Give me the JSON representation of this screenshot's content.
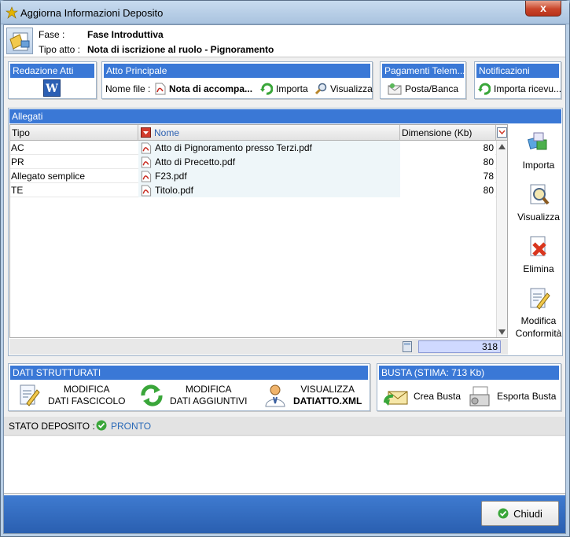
{
  "window": {
    "title": "Aggiorna Informazioni Deposito",
    "close_label": "x"
  },
  "header": {
    "fase_label": "Fase :",
    "fase_value": "Fase Introduttiva",
    "tipo_label": "Tipo atto :",
    "tipo_value": "Nota di iscrizione al ruolo - Pignoramento"
  },
  "redazione": {
    "title": "Redazione Atti",
    "icon": "word-icon"
  },
  "atto_principale": {
    "title": "Atto Principale",
    "file_label": "Nome file :",
    "file_name": "Nota di accompa...",
    "importa": "Importa",
    "visualizza": "Visualizza"
  },
  "pagamenti": {
    "title": "Pagamenti Telem...",
    "action": "Posta/Banca"
  },
  "notifiche": {
    "title": "Notificazioni",
    "action": "Importa ricevu..."
  },
  "allegati": {
    "title": "Allegati",
    "columns": {
      "tipo": "Tipo",
      "nome": "Nome",
      "dimensione": "Dimensione (Kb)"
    },
    "rows": [
      {
        "tipo": "AC",
        "nome": "Atto di Pignoramento presso Terzi.pdf",
        "dim": "80"
      },
      {
        "tipo": "PR",
        "nome": "Atto di Precetto.pdf",
        "dim": "80"
      },
      {
        "tipo": "Allegato semplice",
        "nome": "F23.pdf",
        "dim": "78"
      },
      {
        "tipo": "TE",
        "nome": "Titolo.pdf",
        "dim": "80"
      }
    ],
    "total": "318"
  },
  "side_actions": {
    "importa": "Importa",
    "visualizza": "Visualizza",
    "elimina": "Elimina",
    "modifica_1": "Modifica",
    "modifica_2": "Conformità"
  },
  "dati_strutturati": {
    "title": "DATI STRUTTURATI",
    "fascicolo_1": "MODIFICA",
    "fascicolo_2": "DATI FASCICOLO",
    "aggiuntivi_1": "MODIFICA",
    "aggiuntivi_2": "DATI AGGIUNTIVI",
    "visualizza_1": "VISUALIZZA",
    "visualizza_2": "DATIATTO.XML"
  },
  "busta": {
    "title": "BUSTA (STIMA: 713 Kb)",
    "crea": "Crea Busta",
    "esporta": "Esporta Busta"
  },
  "stato": {
    "label": "STATO DEPOSITO :",
    "value": "PRONTO"
  },
  "footer": {
    "chiudi": "Chiudi"
  },
  "colors": {
    "accent_blue": "#3a78d6",
    "status_green": "#3aa63a",
    "pdf_red": "#c8281e"
  }
}
